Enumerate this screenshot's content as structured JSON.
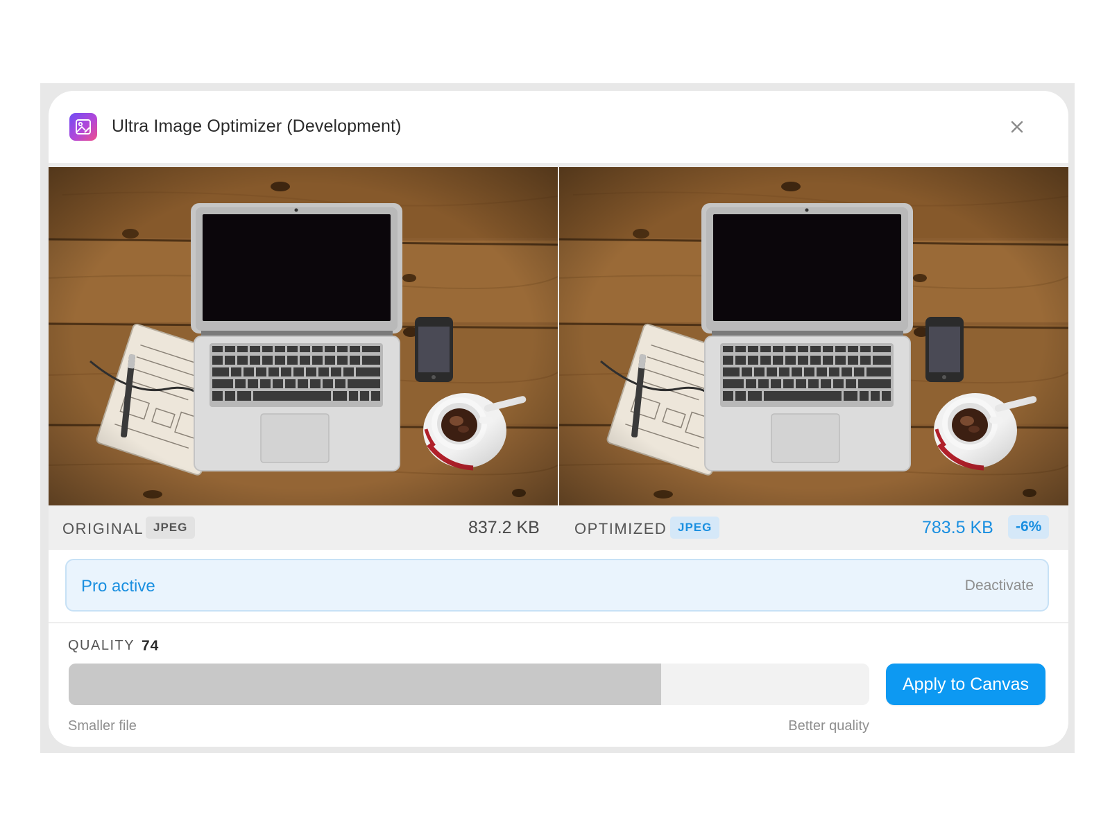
{
  "app": {
    "title": "Ultra Image Optimizer (Development)",
    "icon": "image-edit-icon",
    "close_icon": "close-icon"
  },
  "original": {
    "label": "ORIGINAL",
    "format": "JPEG",
    "size": "837.2 KB"
  },
  "optimized": {
    "label": "OPTIMIZED",
    "format": "JPEG",
    "size": "783.5 KB",
    "change": "-6%"
  },
  "pro": {
    "status": "Pro active",
    "action": "Deactivate"
  },
  "quality": {
    "label": "QUALITY",
    "value": "74",
    "fill_percent": 74,
    "hint_low": "Smaller file",
    "hint_high": "Better quality"
  },
  "apply_button": "Apply to Canvas",
  "colors": {
    "accent": "#0d99f2",
    "accent_text": "#1a8fe0",
    "badge_blue_bg": "#d5e8f8",
    "pro_bg": "#eaf4fd",
    "slider_fill": "#c8c8c8"
  }
}
